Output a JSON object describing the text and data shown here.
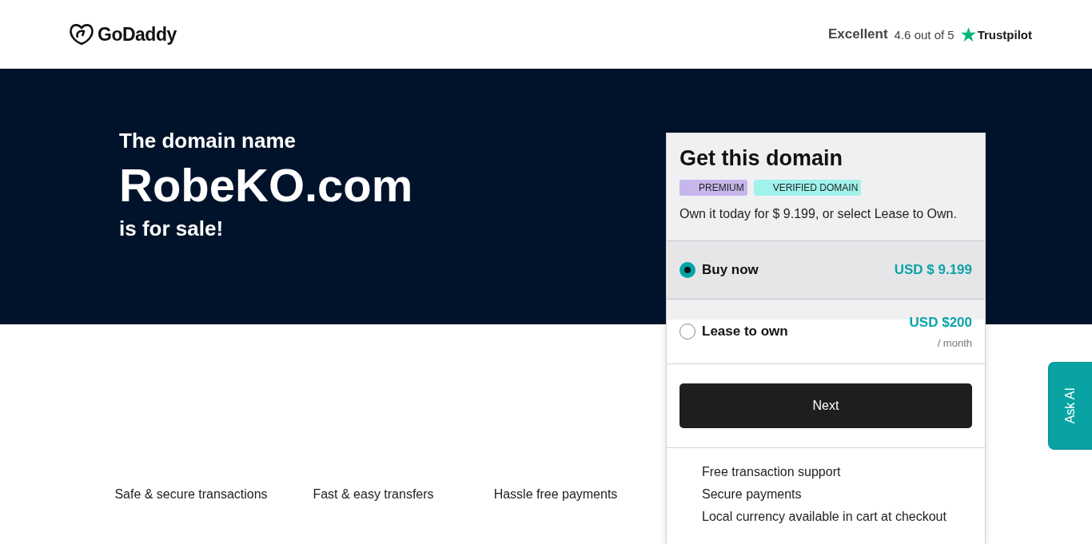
{
  "header": {
    "logo": "GoDaddy",
    "rating_word": "Excellent",
    "rating": "4.6 out of 5",
    "trust_brand": "Trustpilot"
  },
  "hero": {
    "intro": "The domain name",
    "domain": "RobeKO.com",
    "outro": "is for sale!"
  },
  "card": {
    "title": "Get this domain",
    "badges": [
      {
        "label": "PREMIUM",
        "color": "#c6b6ec"
      },
      {
        "label": "VERIFIED DOMAIN",
        "color": "#a0f2eb"
      }
    ],
    "description": "Own it today for $ 9.199, or select Lease to Own.",
    "options": [
      {
        "label": "Buy now",
        "price": "USD $ 9.199",
        "selected": true
      },
      {
        "label": "Lease to own",
        "price": "USD $200",
        "period": "/ month",
        "selected": false
      }
    ],
    "button": "Next",
    "perks": [
      "Free transaction support",
      "Secure payments",
      "Local currency available in cart at checkout"
    ]
  },
  "features": [
    "Safe & secure transactions",
    "Fast & easy transfers",
    "Hassle free payments"
  ],
  "ask_ai": "Ask AI"
}
